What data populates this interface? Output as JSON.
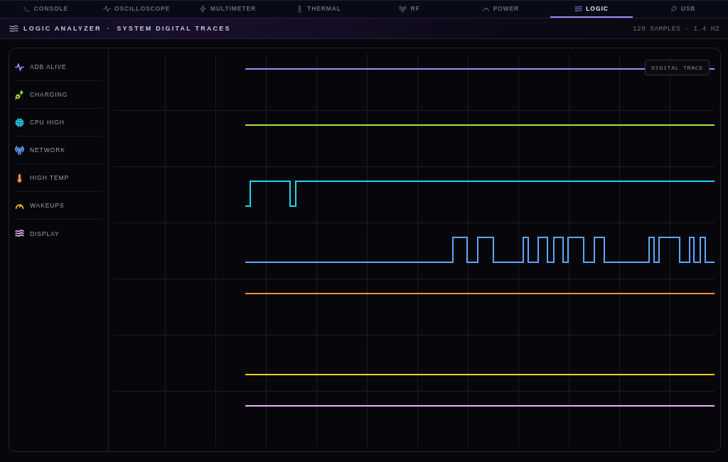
{
  "tabs": [
    {
      "label": "CONSOLE",
      "selected": false
    },
    {
      "label": "OSCILLOSCOPE",
      "selected": false
    },
    {
      "label": "MULTIMETER",
      "selected": false
    },
    {
      "label": "THERMAL",
      "selected": false
    },
    {
      "label": "RF",
      "selected": false
    },
    {
      "label": "POWER",
      "selected": false
    },
    {
      "label": "LOGIC",
      "selected": true
    },
    {
      "label": "USB",
      "selected": false
    }
  ],
  "header": {
    "title": "LOGIC ANALYZER",
    "separator": "·",
    "subtitle": "SYSTEM DIGITAL TRACES",
    "meta": "120 SAMPLES · 1.4 HZ"
  },
  "channels": [
    {
      "name": "ADB ALIVE",
      "color": "#a78bfa"
    },
    {
      "name": "CHARGING",
      "color": "#a3e635"
    },
    {
      "name": "CPU HIGH",
      "color": "#22d3ee"
    },
    {
      "name": "NETWORK",
      "color": "#60a5fa"
    },
    {
      "name": "HIGH TEMP",
      "color": "#fb923c"
    },
    {
      "name": "WAKEUPS",
      "color": "#facc15"
    },
    {
      "name": "DISPLAY",
      "color": "#f0abfc"
    }
  ],
  "trace_area": {
    "tag": "DIGITAL TRACE"
  }
}
